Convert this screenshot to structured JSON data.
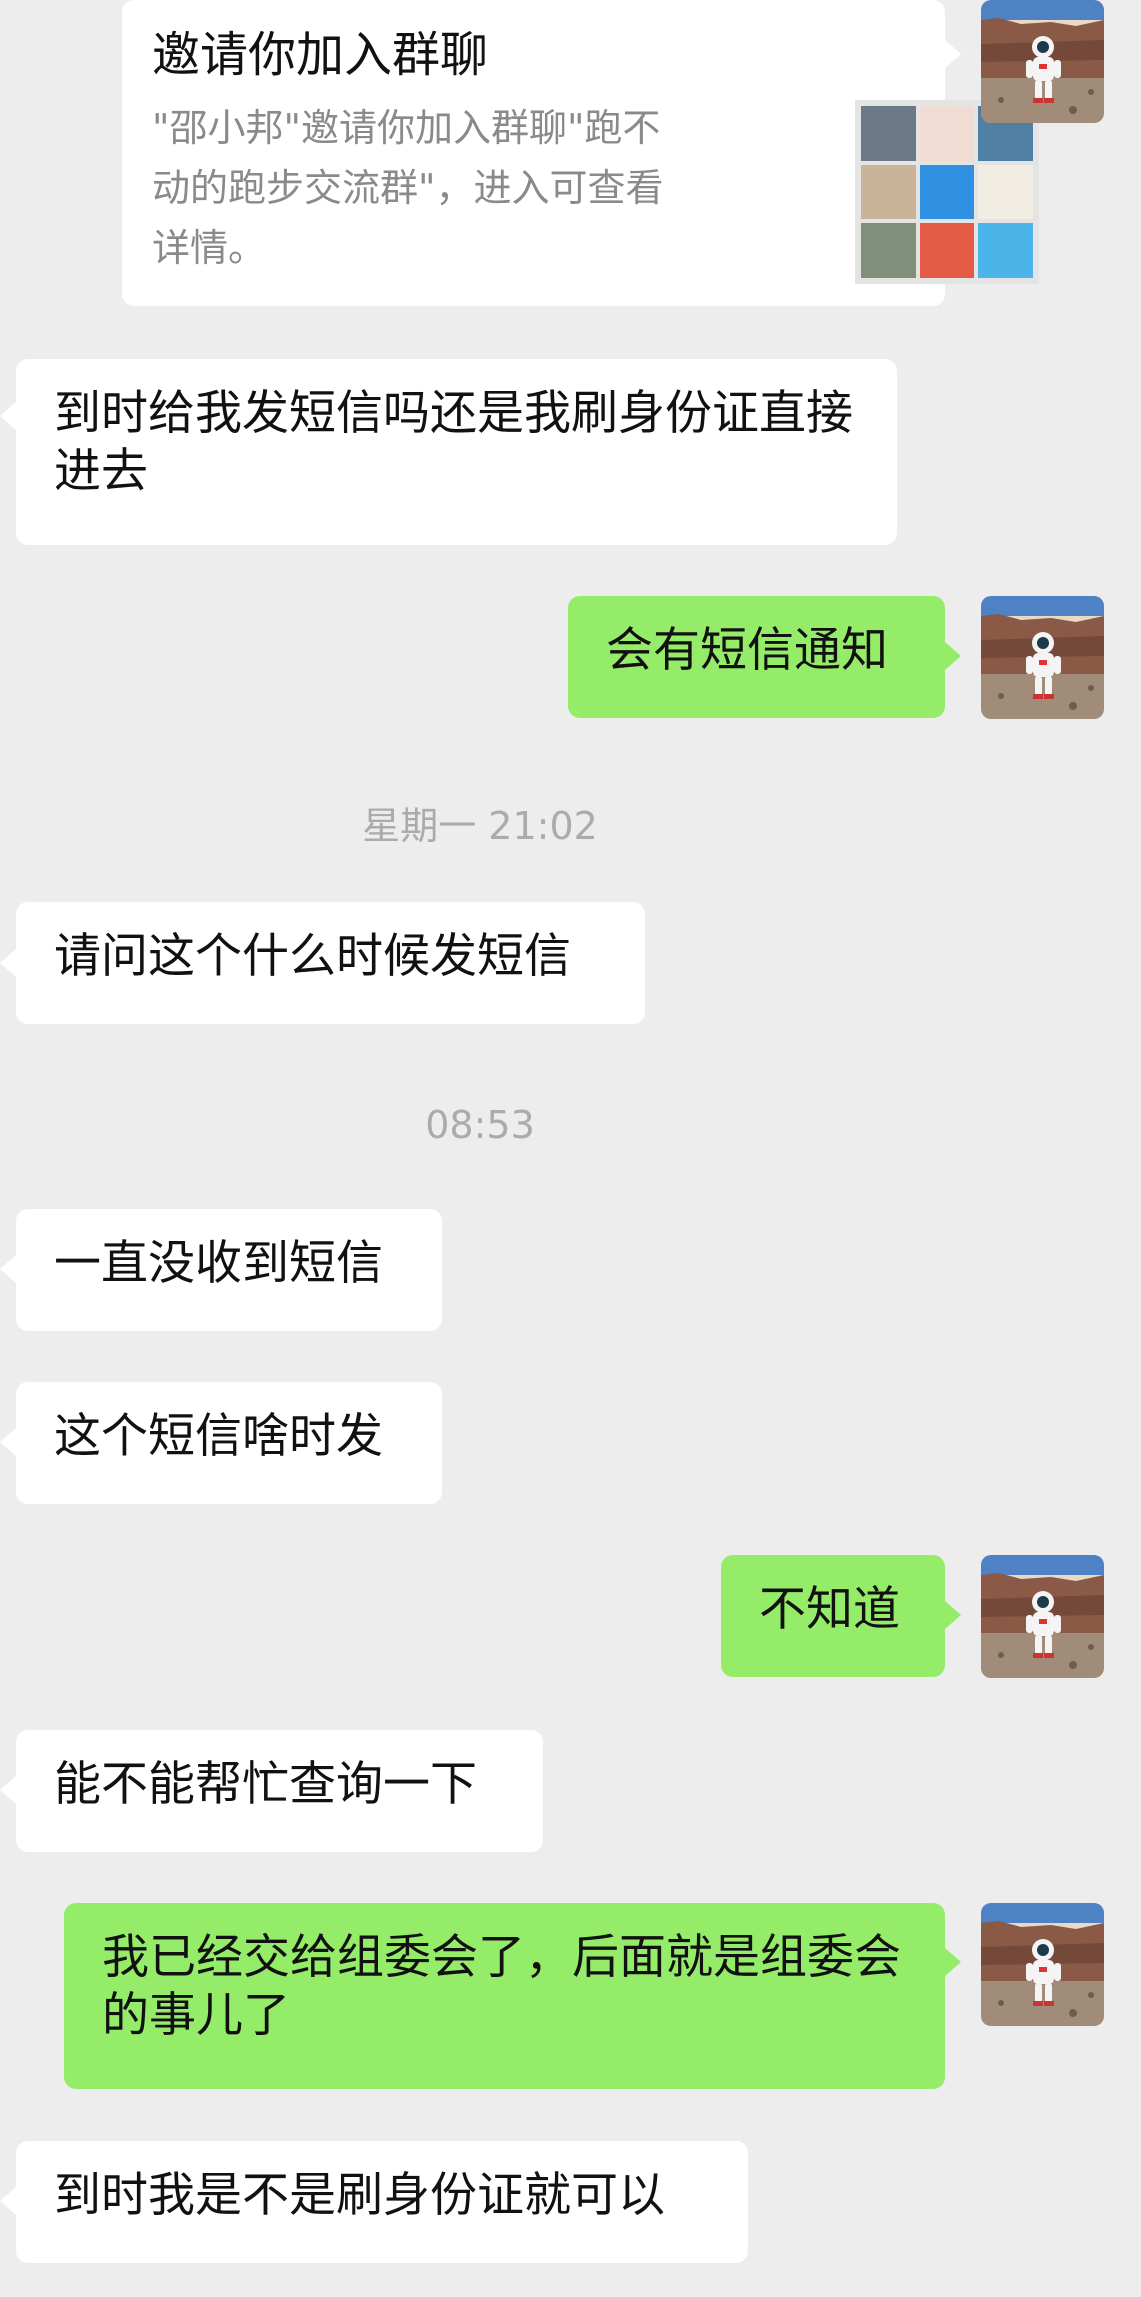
{
  "invite_card": {
    "title": "邀请你加入群聊",
    "description": "\"邵小邦\"邀请你加入群聊\"跑不动的跑步交流群\"，进入可查看详情。",
    "thumb_colors": [
      "#6b7a86",
      "#f1dcd4",
      "#4f7fa3",
      "#c9b49a",
      "#2f8fe0",
      "#f2ede2",
      "#7f8f7a",
      "#e35b45",
      "#4bb4e8"
    ]
  },
  "avatar_icon": "astronaut-avatar-icon",
  "messages": [
    {
      "text": "到时给我发短信吗还是我刷身份证直接进去"
    },
    {
      "text": "会有短信通知"
    },
    {
      "text": "请问这个什么时候发短信"
    },
    {
      "text": "一直没收到短信"
    },
    {
      "text": "这个短信啥时发"
    },
    {
      "text": "不知道"
    },
    {
      "text": "能不能帮忙查询一下"
    },
    {
      "text": "我已经交给组委会了，后面就是组委会的事儿了"
    },
    {
      "text": "到时我是不是刷身份证就可以"
    }
  ],
  "timestamps": [
    "星期一 21:02",
    "08:53"
  ],
  "colors": {
    "background": "#ededed",
    "incoming": "#ffffff",
    "outgoing": "#95ec69"
  }
}
